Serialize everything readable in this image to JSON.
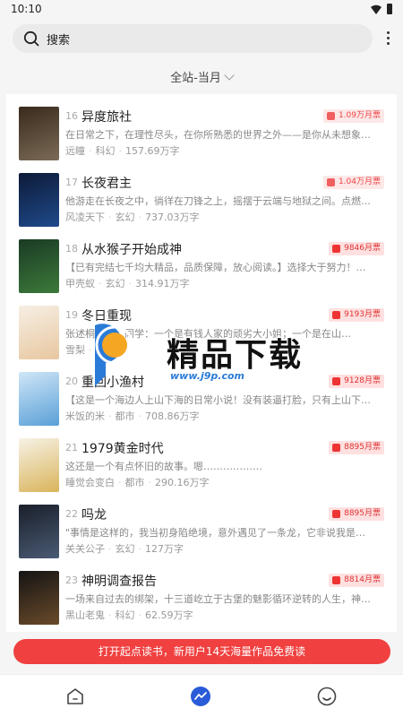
{
  "status": {
    "time": "10:10"
  },
  "search": {
    "placeholder": "搜索"
  },
  "filter": {
    "label": "全站-当月"
  },
  "books": [
    {
      "rank": "16",
      "title": "异度旅社",
      "badge": "1.09万月票",
      "desc": "在日常之下，在理性尽头，在你所熟悉的世界之外——是你从未想象…",
      "author": "远瞳",
      "genre": "科幻",
      "words": "157.69万字",
      "cover_colors": [
        "#3a2a1c",
        "#7a6a56"
      ]
    },
    {
      "rank": "17",
      "title": "长夜君主",
      "badge": "1.04万月票",
      "desc": "他游走在长夜之中，徜徉在刀锋之上，摇摆于云端与地狱之间。点燃…",
      "author": "风凌天下",
      "genre": "玄幻",
      "words": "737.03万字",
      "cover_colors": [
        "#0d1a38",
        "#1f4a8a"
      ]
    },
    {
      "rank": "18",
      "title": "从水猴子开始成神",
      "badge": "9846月票",
      "desc": "【已有完结七千均大精品，品质保障，放心阅读。】选择大于努力！…",
      "author": "甲壳蚁",
      "genre": "玄幻",
      "words": "314.91万字",
      "cover_colors": [
        "#1a3a24",
        "#3c7a3a"
      ]
    },
    {
      "rank": "19",
      "title": "冬日重现",
      "badge": "9193月票",
      "desc": "张述桐同学，同学：一个是有钱人家的顽劣大小姐；一个是在山…",
      "author": "雪梨",
      "genre": "",
      "words": "75",
      "cover_colors": [
        "#f6efe4",
        "#e8c7a0"
      ]
    },
    {
      "rank": "20",
      "title": "重回小渔村",
      "badge": "9128月票",
      "desc": "【这是一个海边人上山下海的日常小说！没有装逼打脸，只有上山下…",
      "author": "米饭的米",
      "genre": "都市",
      "words": "708.86万字",
      "cover_colors": [
        "#cfe6f6",
        "#5aa0d8"
      ]
    },
    {
      "rank": "21",
      "title": "1979黄金时代",
      "badge": "8895月票",
      "desc": "这还是一个有点怀旧的故事。嗯………………",
      "author": "睡觉会变白",
      "genre": "都市",
      "words": "290.16万字",
      "cover_colors": [
        "#f7f2e6",
        "#d9b45a"
      ]
    },
    {
      "rank": "22",
      "title": "吗龙",
      "badge": "8895月票",
      "desc": "\"事情是这样的，我当初身陷绝境，意外遇见了一条龙，它非说我是…",
      "author": "关关公子",
      "genre": "玄幻",
      "words": "127万字",
      "cover_colors": [
        "#1a1f2a",
        "#4a5a74"
      ]
    },
    {
      "rank": "23",
      "title": "神明调查报告",
      "badge": "8814月票",
      "desc": "一场来自过去的绑架，十三道屹立于古堡的魅影循环逆转的人生，神…",
      "author": "黑山老鬼",
      "genre": "科幻",
      "words": "62.59万字",
      "cover_colors": [
        "#141414",
        "#6a4a2a"
      ]
    }
  ],
  "promo": {
    "label": "打开起点读书，新用户14天海量作品免费读"
  },
  "watermark": {
    "text": "精品下载",
    "url": "www.j9p.com"
  }
}
